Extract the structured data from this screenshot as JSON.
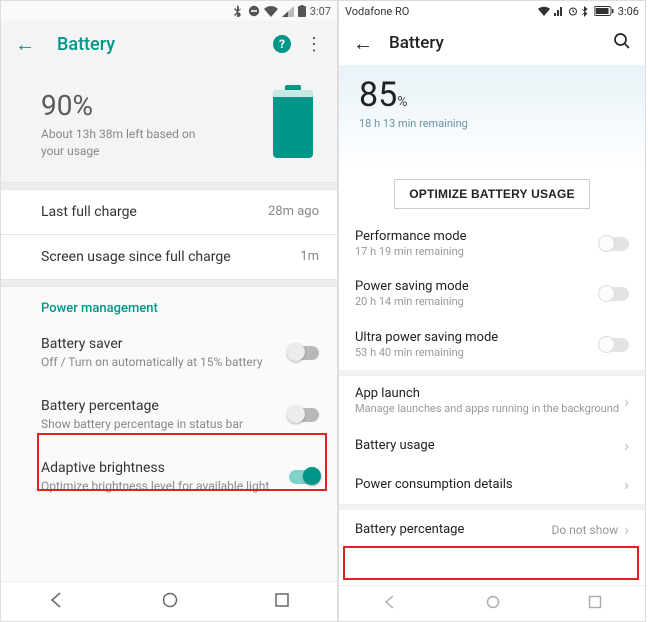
{
  "left": {
    "status": {
      "time": "3:07"
    },
    "appbar": {
      "title": "Battery"
    },
    "summary": {
      "percent": "90%",
      "subtitle": "About 13h 38m left based on your usage"
    },
    "rows": {
      "last_charge_label": "Last full charge",
      "last_charge_value": "28m ago",
      "screen_usage_label": "Screen usage since full charge",
      "screen_usage_value": "1m"
    },
    "section": "Power management",
    "saver": {
      "title": "Battery saver",
      "sub": "Off / Turn on automatically at 15% battery"
    },
    "pct": {
      "title": "Battery percentage",
      "sub": "Show battery percentage in status bar"
    },
    "adaptive": {
      "title": "Adaptive brightness",
      "sub": "Optimize brightness level for available light"
    }
  },
  "right": {
    "status": {
      "carrier": "Vodafone RO",
      "time": "3:06"
    },
    "appbar": {
      "title": "Battery"
    },
    "summary": {
      "percent_num": "85",
      "percent_sym": "%",
      "remaining": "18 h 13 min remaining"
    },
    "optimize": "OPTIMIZE BATTERY USAGE",
    "perf": {
      "title": "Performance mode",
      "sub": "17 h 19 min remaining"
    },
    "power": {
      "title": "Power saving mode",
      "sub": "20 h 14 min remaining"
    },
    "ultra": {
      "title": "Ultra power saving mode",
      "sub": "53 h 40 min remaining"
    },
    "applaunch": {
      "title": "App launch",
      "sub": "Manage launches and apps running in the background"
    },
    "usage": {
      "title": "Battery usage"
    },
    "consumption": {
      "title": "Power consumption details"
    },
    "pct": {
      "title": "Battery percentage",
      "value": "Do not show"
    }
  }
}
